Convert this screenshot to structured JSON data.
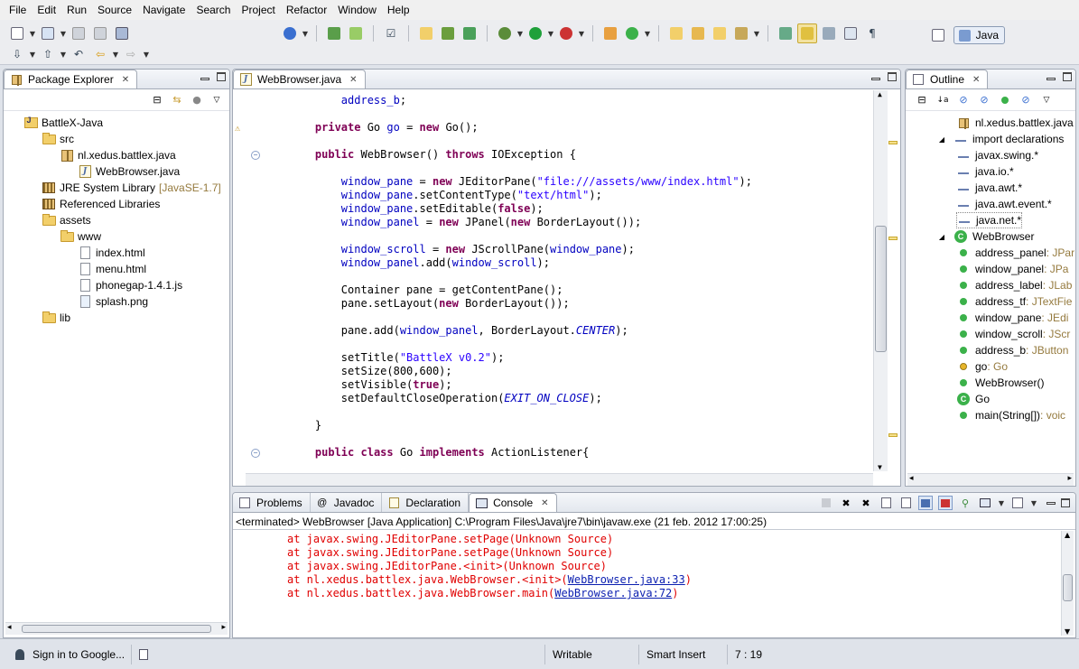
{
  "menu": [
    "File",
    "Edit",
    "Run",
    "Source",
    "Navigate",
    "Search",
    "Project",
    "Refactor",
    "Window",
    "Help"
  ],
  "perspective": {
    "label": "Java"
  },
  "package_explorer": {
    "title": "Package Explorer",
    "items": [
      {
        "label": "BattleX-Java",
        "decoration": ""
      },
      {
        "label": "src",
        "decoration": ""
      },
      {
        "label": "nl.xedus.battlex.java",
        "decoration": ""
      },
      {
        "label": "WebBrowser.java",
        "decoration": ""
      },
      {
        "label": "JRE System Library",
        "decoration": "[JavaSE-1.7]"
      },
      {
        "label": "Referenced Libraries",
        "decoration": ""
      },
      {
        "label": "assets",
        "decoration": ""
      },
      {
        "label": "www",
        "decoration": ""
      },
      {
        "label": "index.html",
        "decoration": ""
      },
      {
        "label": "menu.html",
        "decoration": ""
      },
      {
        "label": "phonegap-1.4.1.js",
        "decoration": ""
      },
      {
        "label": "splash.png",
        "decoration": ""
      },
      {
        "label": "lib",
        "decoration": ""
      }
    ]
  },
  "editor": {
    "tab_title": "WebBrowser.java",
    "lines": [
      "        address_b;",
      "",
      "    private Go go = new Go();",
      "",
      "    public WebBrowser() throws IOException {",
      "",
      "        window_pane = new JEditorPane(\"file:///assets/www/index.html\");",
      "        window_pane.setContentType(\"text/html\");",
      "        window_pane.setEditable(false);",
      "        window_panel = new JPanel(new BorderLayout());",
      "",
      "        window_scroll = new JScrollPane(window_pane);",
      "        window_panel.add(window_scroll);",
      "",
      "        Container pane = getContentPane();",
      "        pane.setLayout(new BorderLayout());",
      "",
      "        pane.add(window_panel, BorderLayout.CENTER);",
      "",
      "        setTitle(\"BattleX v0.2\");",
      "        setSize(800,600);",
      "        setVisible(true);",
      "        setDefaultCloseOperation(EXIT_ON_CLOSE);",
      "",
      "    }",
      "",
      "    public class Go implements ActionListener{"
    ]
  },
  "outline": {
    "title": "Outline",
    "items": [
      {
        "label": "nl.xedus.battlex.java",
        "type": ""
      },
      {
        "label": "import declarations",
        "type": ""
      },
      {
        "label": "javax.swing.*",
        "type": ""
      },
      {
        "label": "java.io.*",
        "type": ""
      },
      {
        "label": "java.awt.*",
        "type": ""
      },
      {
        "label": "java.awt.event.*",
        "type": ""
      },
      {
        "label": "java.net.*",
        "type": ""
      },
      {
        "label": "WebBrowser",
        "type": ""
      },
      {
        "label": "address_panel",
        "type": " : JPar"
      },
      {
        "label": "window_panel",
        "type": " : JPa"
      },
      {
        "label": "address_label",
        "type": " : JLab"
      },
      {
        "label": "address_tf",
        "type": " : JTextFie"
      },
      {
        "label": "window_pane",
        "type": " : JEdi"
      },
      {
        "label": "window_scroll",
        "type": " : JScr"
      },
      {
        "label": "address_b",
        "type": " : JButton"
      },
      {
        "label": "go",
        "type": " : Go"
      },
      {
        "label": "WebBrowser()",
        "type": ""
      },
      {
        "label": "Go",
        "type": ""
      },
      {
        "label": "main(String[])",
        "type": " : voic"
      }
    ]
  },
  "bottom_tabs": {
    "problems": "Problems",
    "javadoc": "Javadoc",
    "declaration": "Declaration",
    "console": "Console"
  },
  "console": {
    "header": "<terminated> WebBrowser [Java Application] C:\\Program Files\\Java\\jre7\\bin\\javaw.exe (21 feb. 2012 17:00:25)",
    "lines": [
      {
        "text": "at javax.swing.JEditorPane.setPage(Unknown Source)",
        "link": "",
        "tail": ""
      },
      {
        "text": "at javax.swing.JEditorPane.setPage(Unknown Source)",
        "link": "",
        "tail": ""
      },
      {
        "text": "at javax.swing.JEditorPane.<init>(Unknown Source)",
        "link": "",
        "tail": ""
      },
      {
        "text": "at nl.xedus.battlex.java.WebBrowser.<init>(",
        "link": "WebBrowser.java:33",
        "tail": ")"
      },
      {
        "text": "at nl.xedus.battlex.java.WebBrowser.main(",
        "link": "WebBrowser.java:72",
        "tail": ")"
      }
    ]
  },
  "status": {
    "signin": "Sign in to Google...",
    "writable": "Writable",
    "insert_mode": "Smart Insert",
    "position": "7 : 19"
  },
  "colors": {
    "keyword": "#7f0055",
    "field": "#0000c0",
    "string": "#2a00ff",
    "error": "#e00000"
  }
}
